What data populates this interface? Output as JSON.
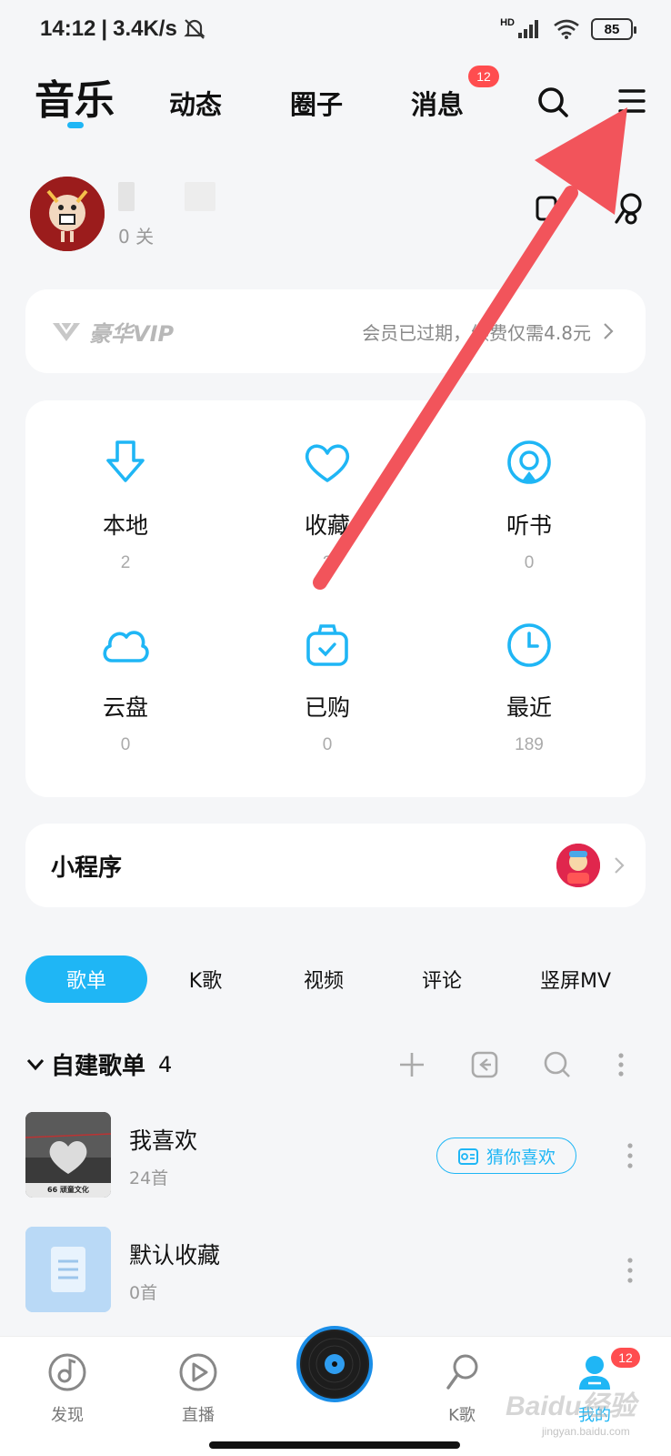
{
  "status_bar": {
    "time": "14:12",
    "separator": "|",
    "speed": "3.4K/s",
    "network": "HD",
    "battery": "85"
  },
  "top_nav": {
    "tabs": [
      "音乐",
      "动态",
      "圈子",
      "消息"
    ],
    "badge": "12",
    "icons": [
      "search-icon",
      "menu-icon"
    ]
  },
  "profile": {
    "follow_text": "0 关"
  },
  "vip": {
    "label": "豪华VIP",
    "message": "会员已过期，续费仅需4.8元"
  },
  "grid": [
    {
      "label": "本地",
      "count": "2",
      "icon": "download-icon"
    },
    {
      "label": "收藏",
      "count": "2",
      "icon": "heart-icon"
    },
    {
      "label": "听书",
      "count": "0",
      "icon": "audiobook-icon"
    },
    {
      "label": "云盘",
      "count": "0",
      "icon": "cloud-icon"
    },
    {
      "label": "已购",
      "count": "0",
      "icon": "purchased-icon"
    },
    {
      "label": "最近",
      "count": "189",
      "icon": "clock-icon"
    }
  ],
  "mini_program": {
    "title": "小程序"
  },
  "sub_tabs": [
    "歌单",
    "K歌",
    "视频",
    "评论",
    "竖屏MV"
  ],
  "playlist_section": {
    "title": "自建歌单",
    "count": "4"
  },
  "playlists": [
    {
      "name": "我喜欢",
      "sub": "24首",
      "cover_text": "66 顽童文化",
      "action": "猜你喜欢"
    },
    {
      "name": "默认收藏",
      "sub": "0首"
    }
  ],
  "bottom_nav": {
    "items": [
      "发现",
      "直播",
      "K歌",
      "我的"
    ],
    "badge": "12"
  },
  "watermark": {
    "text": "Baidu经验",
    "sub": "jingyan.baidu.com"
  },
  "colors": {
    "accent": "#1fb6f5",
    "badge": "#ff4d4f",
    "arrow": "#f2545b"
  }
}
